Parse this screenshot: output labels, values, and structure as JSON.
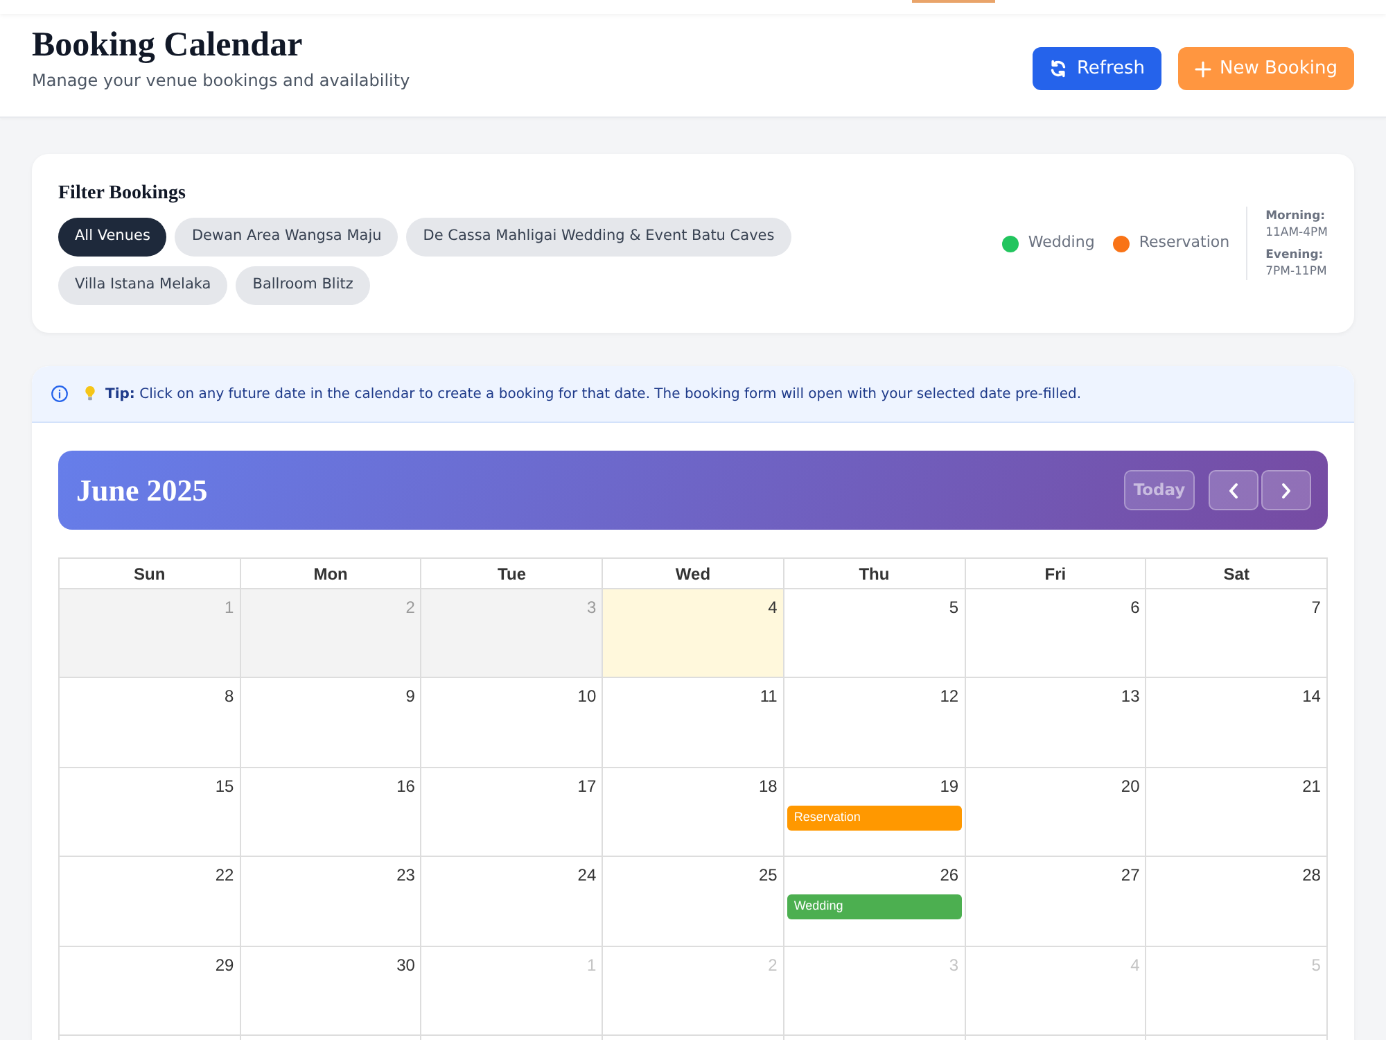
{
  "header": {
    "title": "Booking Calendar",
    "subtitle": "Manage your venue bookings and availability",
    "buttons": [
      {
        "kind": "refresh",
        "label": "Refresh"
      },
      {
        "kind": "create",
        "label": "New Booking"
      }
    ]
  },
  "filter": {
    "title": "Filter Bookings",
    "venues": [
      {
        "label": "All Venues",
        "selected": true
      },
      {
        "label": "Dewan Area Wangsa Maju",
        "selected": false
      },
      {
        "label": "De Cassa Mahligai Wedding & Event Batu Caves",
        "selected": false
      },
      {
        "label": "Villa Istana Melaka",
        "selected": false
      },
      {
        "label": "Ballroom Blitz",
        "selected": false
      }
    ],
    "legend": [
      {
        "label": "Wedding",
        "color": "#22c55e"
      },
      {
        "label": "Reservation",
        "color": "#f97316"
      }
    ],
    "hours": [
      {
        "label": "Morning:",
        "time": "11AM-4PM"
      },
      {
        "label": "Evening:",
        "time": "7PM-11PM"
      }
    ]
  },
  "tip": {
    "text": "**Tip:** Click on any future date in the calendar to create a booking for that date. The booking form will open with your selected date pre-filled."
  },
  "calendar": {
    "title": "June 2025",
    "today_button": {
      "label": "Today",
      "disabled": true
    },
    "weekdays": [
      "Sun",
      "Mon",
      "Tue",
      "Wed",
      "Thu",
      "Fri",
      "Sat"
    ],
    "weeks": [
      [
        {
          "day": "1",
          "kind": "past"
        },
        {
          "day": "2",
          "kind": "past"
        },
        {
          "day": "3",
          "kind": "past"
        },
        {
          "day": "4",
          "kind": "today"
        },
        {
          "day": "5",
          "kind": "day"
        },
        {
          "day": "6",
          "kind": "day"
        },
        {
          "day": "7",
          "kind": "day"
        }
      ],
      [
        {
          "day": "8",
          "kind": "day"
        },
        {
          "day": "9",
          "kind": "day"
        },
        {
          "day": "10",
          "kind": "day"
        },
        {
          "day": "11",
          "kind": "day"
        },
        {
          "day": "12",
          "kind": "day"
        },
        {
          "day": "13",
          "kind": "day"
        },
        {
          "day": "14",
          "kind": "day"
        }
      ],
      [
        {
          "day": "15",
          "kind": "day"
        },
        {
          "day": "16",
          "kind": "day"
        },
        {
          "day": "17",
          "kind": "day"
        },
        {
          "day": "18",
          "kind": "day"
        },
        {
          "day": "19",
          "kind": "day",
          "events": [
            {
              "label": "Reservation",
              "color": "#ff9800"
            }
          ]
        },
        {
          "day": "20",
          "kind": "day"
        },
        {
          "day": "21",
          "kind": "day"
        }
      ],
      [
        {
          "day": "22",
          "kind": "day"
        },
        {
          "day": "23",
          "kind": "day"
        },
        {
          "day": "24",
          "kind": "day"
        },
        {
          "day": "25",
          "kind": "day"
        },
        {
          "day": "26",
          "kind": "day",
          "events": [
            {
              "label": "Wedding",
              "color": "#4caf50"
            }
          ]
        },
        {
          "day": "27",
          "kind": "day"
        },
        {
          "day": "28",
          "kind": "day"
        }
      ],
      [
        {
          "day": "29",
          "kind": "day"
        },
        {
          "day": "30",
          "kind": "day"
        },
        {
          "day": "1",
          "kind": "other"
        },
        {
          "day": "2",
          "kind": "other"
        },
        {
          "day": "3",
          "kind": "other"
        },
        {
          "day": "4",
          "kind": "other"
        },
        {
          "day": "5",
          "kind": "other"
        }
      ]
    ]
  }
}
